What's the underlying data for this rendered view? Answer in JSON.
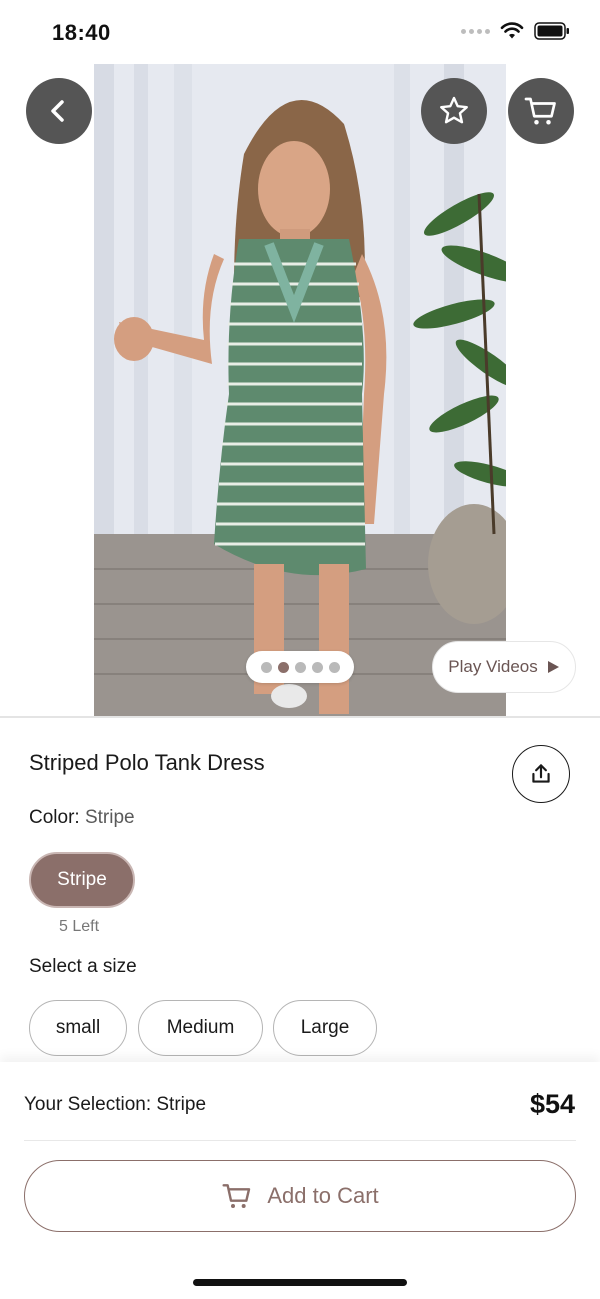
{
  "status_bar": {
    "time": "18:40"
  },
  "hero": {
    "page_count": 5,
    "active_page_index": 1,
    "play_videos_label": "Play Videos"
  },
  "product": {
    "title": "Striped Polo Tank Dress",
    "color_prefix": "Color: ",
    "color_value": "Stripe",
    "swatch_label": "Stripe",
    "stock_text": "5 Left",
    "size_prompt": "Select a size",
    "sizes": [
      "small",
      "Medium",
      "Large"
    ]
  },
  "bottom": {
    "selection_text": "Your Selection: Stripe",
    "price": "$54",
    "add_to_cart_label": "Add to Cart"
  },
  "colors": {
    "accent": "#8b6f6a",
    "icon_button_bg": "#555555"
  }
}
